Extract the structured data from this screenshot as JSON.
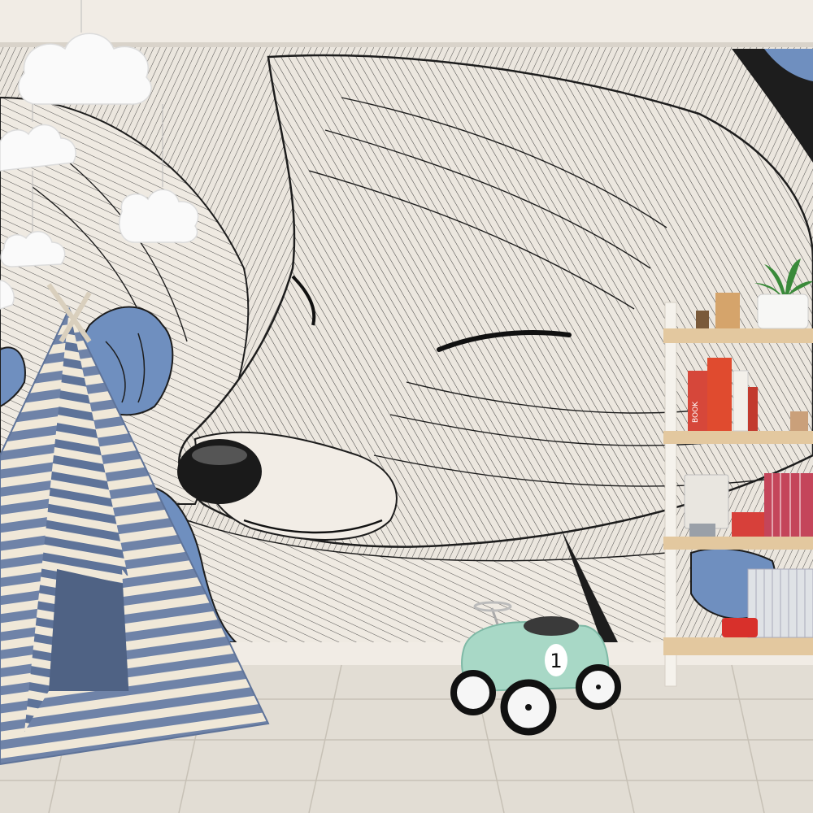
{
  "scene": {
    "description_labels": {
      "sign_on_books": "BOOK"
    },
    "toy_car": {
      "number": "1"
    },
    "colors": {
      "wall_bg": "#ece7df",
      "mural_line": "#1d1d1d",
      "mural_blue": "#6f8fbf",
      "molding": "#f1ece5",
      "floor": "#e2ddd4",
      "floor_line": "#c7c1b6",
      "teepee_blue": "#6f83a8",
      "teepee_cream": "#f0e8d8",
      "car_body": "#a8d8c6",
      "shelf_wood": "#e3c89f",
      "shelf_frame": "#f5f2ec",
      "plant_green": "#3a8a3a"
    }
  }
}
